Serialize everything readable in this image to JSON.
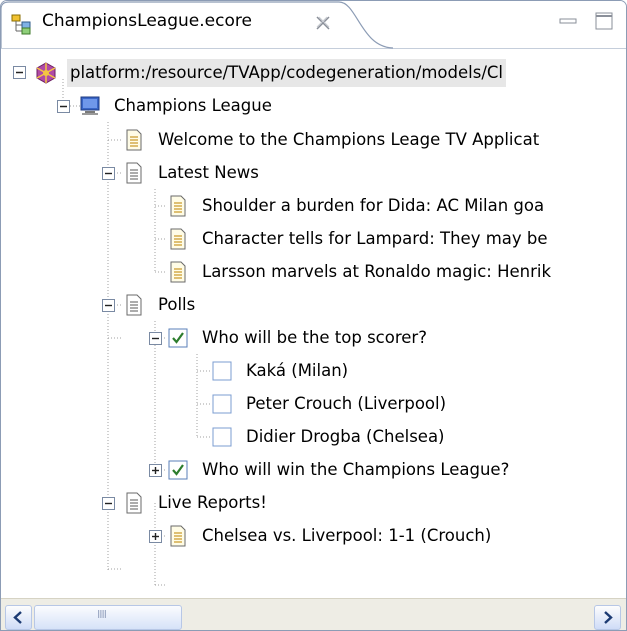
{
  "tab": {
    "title": "ChampionsLeague.ecore",
    "icon": "ecore-model-icon",
    "close_icon": "close-tab-icon"
  },
  "window_controls": {
    "minimize_icon": "minimize-icon",
    "maximize_icon": "maximize-icon"
  },
  "tree": {
    "root": {
      "label": "platform:/resource/TVApp/codegeneration/models/Cl",
      "icon": "resource-icon",
      "expanded": true,
      "selected": true
    },
    "app": {
      "label": "Champions League",
      "icon": "application-icon",
      "expanded": true
    },
    "welcome": {
      "label": "Welcome to the Champions Leage TV Applicat",
      "icon": "page-icon"
    },
    "news": {
      "label": "Latest News",
      "icon": "page-icon",
      "expanded": true,
      "items": [
        "Shoulder a burden for Dida: AC Milan goa",
        "Character tells for Lampard: They may be",
        "Larsson marvels at Ronaldo magic: Henrik"
      ]
    },
    "polls": {
      "label": "Polls",
      "icon": "page-icon",
      "expanded": true,
      "question1": {
        "label": "Who will be the top scorer?",
        "icon": "checked-box-icon",
        "expanded": true
      },
      "answers": [
        "Kaká (Milan)",
        "Peter Crouch (Liverpool)",
        "Didier Drogba (Chelsea)"
      ],
      "question2": {
        "label": "Who will win the Champions League?",
        "icon": "checked-box-icon",
        "expanded": false
      }
    },
    "reports": {
      "label": "Live Reports!",
      "icon": "page-icon",
      "expanded": true,
      "match": {
        "label": "Chelsea vs. Liverpool: 1-1 (Crouch)",
        "icon": "page-icon",
        "expanded": false
      }
    }
  },
  "scrollbar": {
    "grip_label": "IIII"
  },
  "colors": {
    "selection": "#e7e7e7",
    "frame": "#8c9cb5",
    "scrollbar_track": "#eeede5"
  }
}
